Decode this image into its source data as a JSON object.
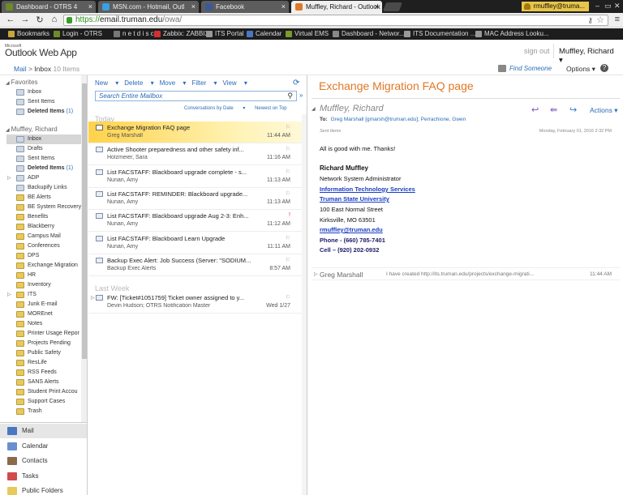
{
  "browser": {
    "tabs": [
      {
        "title": "Dashboard - OTRS 4",
        "icon_color": "#6c8b2a",
        "active": false
      },
      {
        "title": "MSN.com - Hotmail, Outl",
        "icon_color": "#3aa0e0",
        "active": false
      },
      {
        "title": "Facebook",
        "icon_color": "#3b5998",
        "active": false
      },
      {
        "title": "Muffley, Richard - Outlook",
        "icon_color": "#e07826",
        "active": true
      }
    ],
    "profile": "rmuffley@truma...",
    "url_scheme": "https://",
    "url_host": "email.truman.edu",
    "url_path": "/owa/",
    "bookmarks": [
      {
        "label": "Bookmarks",
        "icon_color": "#c9a63a"
      },
      {
        "label": "Login - OTRS",
        "icon_color": "#6c8b2a"
      },
      {
        "label": "n e t d i s c o",
        "icon_color": "#777777"
      },
      {
        "label": "Zabbix: ZABBIX",
        "icon_color": "#d32f2f"
      },
      {
        "label": "ITS Portal",
        "icon_color": "#999999"
      },
      {
        "label": "Calendar",
        "icon_color": "#4a77c2"
      },
      {
        "label": "Virtual EMS",
        "icon_color": "#7a9a2a"
      },
      {
        "label": "Dashboard - Networ...",
        "icon_color": "#888888"
      },
      {
        "label": "ITS Documentation ...",
        "icon_color": "#999999"
      },
      {
        "label": "MAC Address Looku...",
        "icon_color": "#999999"
      }
    ]
  },
  "owa": {
    "logo_small": "Microsoft",
    "logo": "Outlook Web App",
    "sign_out": "sign out",
    "user": "Muffley, Richard",
    "breadcrumb": {
      "root": "Mail",
      "sep": ">",
      "current": "Inbox",
      "count": "10 Items"
    },
    "find_someone": "Find Someone",
    "options": "Options",
    "help": "?"
  },
  "folders": {
    "favorites_label": "Favorites",
    "favorites": [
      {
        "label": "Inbox",
        "bold": false,
        "count": ""
      },
      {
        "label": "Sent Items",
        "bold": false,
        "count": ""
      },
      {
        "label": "Deleted Items",
        "bold": true,
        "count": "(1)"
      }
    ],
    "mailbox_label": "Muffley, Richard",
    "mailbox": [
      {
        "label": "Inbox",
        "sel": true,
        "bold": false,
        "count": "",
        "expand": false
      },
      {
        "label": "Drafts",
        "sel": false,
        "bold": false,
        "count": "",
        "expand": false
      },
      {
        "label": "Sent Items",
        "sel": false,
        "bold": false,
        "count": "",
        "expand": false
      },
      {
        "label": "Deleted Items",
        "sel": false,
        "bold": true,
        "count": "(1)",
        "expand": false
      },
      {
        "label": "ADP",
        "sel": false,
        "bold": false,
        "count": "",
        "expand": true
      },
      {
        "label": "Backupify Links",
        "sel": false,
        "bold": false,
        "count": "",
        "expand": false
      },
      {
        "label": "BE Alerts",
        "sel": false,
        "bold": false,
        "count": "",
        "expand": false
      },
      {
        "label": "BE System Recovery",
        "sel": false,
        "bold": false,
        "count": "",
        "expand": false
      },
      {
        "label": "Benefits",
        "sel": false,
        "bold": false,
        "count": "",
        "expand": false
      },
      {
        "label": "Blackberry",
        "sel": false,
        "bold": false,
        "count": "",
        "expand": false
      },
      {
        "label": "Campus Mail",
        "sel": false,
        "bold": false,
        "count": "",
        "expand": false
      },
      {
        "label": "Conferences",
        "sel": false,
        "bold": false,
        "count": "",
        "expand": false
      },
      {
        "label": "DPS",
        "sel": false,
        "bold": false,
        "count": "",
        "expand": false
      },
      {
        "label": "Exchange Migration",
        "sel": false,
        "bold": false,
        "count": "",
        "expand": false
      },
      {
        "label": "HR",
        "sel": false,
        "bold": false,
        "count": "",
        "expand": false
      },
      {
        "label": "Inventory",
        "sel": false,
        "bold": false,
        "count": "",
        "expand": false
      },
      {
        "label": "ITS",
        "sel": false,
        "bold": false,
        "count": "",
        "expand": true
      },
      {
        "label": "Junk E-mail",
        "sel": false,
        "bold": false,
        "count": "",
        "expand": false
      },
      {
        "label": "MOREnet",
        "sel": false,
        "bold": false,
        "count": "",
        "expand": false
      },
      {
        "label": "Notes",
        "sel": false,
        "bold": false,
        "count": "",
        "expand": false
      },
      {
        "label": "Printer Usage Repor",
        "sel": false,
        "bold": false,
        "count": "",
        "expand": false
      },
      {
        "label": "Projects Pending",
        "sel": false,
        "bold": false,
        "count": "",
        "expand": false
      },
      {
        "label": "Public Safety",
        "sel": false,
        "bold": false,
        "count": "",
        "expand": false
      },
      {
        "label": "ResLife",
        "sel": false,
        "bold": false,
        "count": "",
        "expand": false
      },
      {
        "label": "RSS Feeds",
        "sel": false,
        "bold": false,
        "count": "",
        "expand": false
      },
      {
        "label": "SANS Alerts",
        "sel": false,
        "bold": false,
        "count": "",
        "expand": false
      },
      {
        "label": "Student Print Accou",
        "sel": false,
        "bold": false,
        "count": "",
        "expand": false
      },
      {
        "label": "Support Cases",
        "sel": false,
        "bold": false,
        "count": "",
        "expand": false
      },
      {
        "label": "Trash",
        "sel": false,
        "bold": false,
        "count": "",
        "expand": false
      }
    ],
    "nav": [
      {
        "label": "Mail",
        "icon": "mail-icon",
        "color": "#4a77c2",
        "sel": true
      },
      {
        "label": "Calendar",
        "icon": "calendar-icon",
        "color": "#6a8fcf",
        "sel": false
      },
      {
        "label": "Contacts",
        "icon": "contacts-icon",
        "color": "#8a6a4a",
        "sel": false
      },
      {
        "label": "Tasks",
        "icon": "tasks-icon",
        "color": "#d04a4a",
        "sel": false
      },
      {
        "label": "Public Folders",
        "icon": "public-folders-icon",
        "color": "#e8c95b",
        "sel": false
      }
    ]
  },
  "list": {
    "toolbar": [
      "New",
      "Delete",
      "Move",
      "Filter",
      "View"
    ],
    "search_placeholder": "Search Entire Mailbox",
    "sort": [
      "Conversations by Date",
      "Newest on Top"
    ],
    "group_today": "Today",
    "group_lastweek": "Last Week",
    "messages": [
      {
        "subject": "Exchange Migration FAQ page",
        "from": "Greg Marshall",
        "time": "11:44 AM",
        "selected": true,
        "flag": "",
        "expand": false
      },
      {
        "subject": "Active Shooter preparedness and other safety inf...",
        "from": "Holzmeier, Sara",
        "time": "11:16 AM",
        "selected": false,
        "flag": "",
        "expand": false
      },
      {
        "subject": "List FACSTAFF: Blackboard upgrade complete - s...",
        "from": "Nunan, Amy",
        "time": "11:13 AM",
        "selected": false,
        "flag": "",
        "expand": false
      },
      {
        "subject": "List FACSTAFF: REMINDER: Blackboard upgrade...",
        "from": "Nunan, Amy",
        "time": "11:13 AM",
        "selected": false,
        "flag": "",
        "expand": false
      },
      {
        "subject": "List FACSTAFF: Blackboard upgrade Aug 2-3: Enh...",
        "from": "Nunan, Amy",
        "time": "11:12 AM",
        "selected": false,
        "flag": "!",
        "expand": false
      },
      {
        "subject": "List FACSTAFF: Blackboard Learn Upgrade",
        "from": "Nunan, Amy",
        "time": "11:11 AM",
        "selected": false,
        "flag": "",
        "expand": false
      },
      {
        "subject": "Backup Exec Alert: Job Success (Server: \"SODIUM...",
        "from": "Backup Exec Alerts",
        "time": "8:57 AM",
        "selected": false,
        "flag": "",
        "expand": false
      },
      {
        "subject": "FW: [Ticket#1051759] Ticket owner assigned to y...",
        "from": "Devin Hudson; OTRS Notification Master",
        "time": "Wed 1/27",
        "selected": false,
        "flag": "",
        "expand": true
      }
    ]
  },
  "reading": {
    "title": "Exchange Migration FAQ page",
    "sender": "Muffley, Richard",
    "actions": "Actions",
    "to_label": "To:",
    "to": "Greg Marshall [gmarsh@truman.edu]; Perrachione, Gwen",
    "folder": "Sent Items",
    "date": "Monday, February 01, 2016 2:32 PM",
    "body": "All is good with me.  Thanks!",
    "signature": {
      "name": "Richard Muffley",
      "role": "Network System Administrator",
      "dept": "Information Technology Services",
      "univ": "Truman State University",
      "street": "100 East Normal Street",
      "city": "Kirksville, MO 63501",
      "email": "rmuffley@truman.edu",
      "phone": "Phone - (660) 785-7401",
      "cell": "Cell – (920) 202-0932"
    },
    "conversation": {
      "from": "Greg Marshall",
      "preview": "I have created http://its.truman.edu/projects/exchange-migrati...",
      "time": "11:44 AM"
    }
  }
}
